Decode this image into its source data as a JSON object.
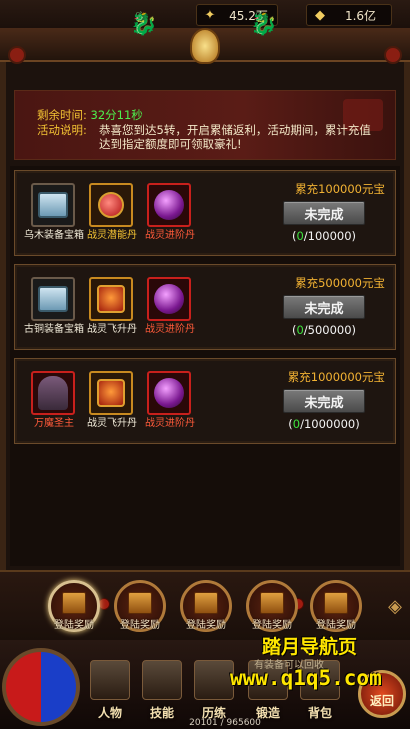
{
  "currency": {
    "ingot": "45.2万",
    "gold": "1.6亿"
  },
  "banner": {
    "time_label": "剩余时间:",
    "time_value": "32分11秒",
    "desc_label": "活动说明:",
    "desc_text": "恭喜您到达5转，开启累储返利，活动期间，累计充值达到指定额度即可领取豪礼!"
  },
  "rewards": [
    {
      "target": "累充100000元宝",
      "status": "未完成",
      "progress_current": "0",
      "progress_total": "/100000",
      "items": [
        {
          "name": "乌木装备宝箱",
          "icon": "blue-chest-icon",
          "style": "white"
        },
        {
          "name": "战灵潜能丹",
          "icon": "red-pill-icon",
          "style": "gold"
        },
        {
          "name": "战灵进阶丹",
          "icon": "purple-orb-icon",
          "style": "red"
        }
      ]
    },
    {
      "target": "累充500000元宝",
      "status": "未完成",
      "progress_current": "0",
      "progress_total": "/500000",
      "items": [
        {
          "name": "古铜装备宝箱",
          "icon": "blue-chest-icon",
          "style": "white"
        },
        {
          "name": "战灵飞升丹",
          "icon": "fly-pill-icon",
          "style": "gold"
        },
        {
          "name": "战灵进阶丹",
          "icon": "purple-orb-icon",
          "style": "red"
        }
      ]
    },
    {
      "target": "累充1000000元宝",
      "status": "未完成",
      "progress_current": "0",
      "progress_total": "/1000000",
      "items": [
        {
          "name": "万魔圣主",
          "icon": "character-icon",
          "style": "red"
        },
        {
          "name": "战灵飞升丹",
          "icon": "fly-pill-icon",
          "style": "gold"
        },
        {
          "name": "战灵进阶丹",
          "icon": "purple-orb-icon",
          "style": "red"
        }
      ]
    }
  ],
  "login_rewards": [
    "登陆奖励",
    "登陆奖励",
    "登陆奖励",
    "登陆奖励",
    "登陆奖励"
  ],
  "nav": {
    "character": "人物",
    "skills": "技能",
    "training": "历练",
    "forge": "锻造",
    "bag": "背包",
    "return": "返回"
  },
  "exp_readout": "20101 / 965600",
  "watermark": {
    "title": "踏月导航页",
    "url": "www.q1q5.com",
    "sub": "有装备可以回收"
  }
}
